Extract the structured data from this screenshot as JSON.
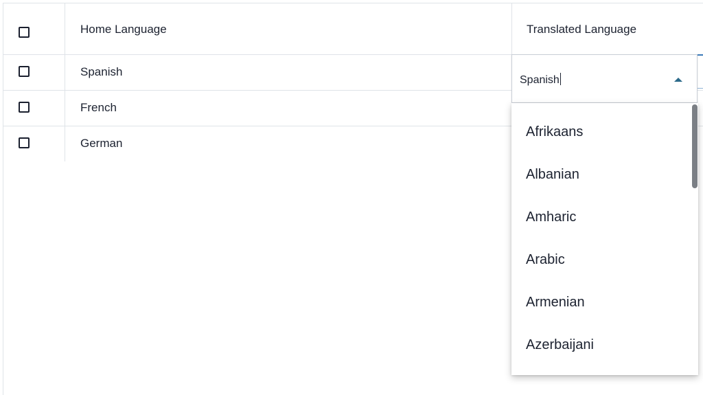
{
  "table": {
    "columns": {
      "home_language": "Home Language",
      "translated_language": "Translated Language"
    },
    "rows": [
      {
        "home_language": "Spanish"
      },
      {
        "home_language": "French"
      },
      {
        "home_language": "German"
      }
    ]
  },
  "dropdown": {
    "input_value": "Spanish",
    "arrow_icon": "triangle-up-icon",
    "options": [
      "Afrikaans",
      "Albanian",
      "Amharic",
      "Arabic",
      "Armenian",
      "Azerbaijani"
    ]
  },
  "colors": {
    "border": "#dfe3e8",
    "arrow": "#2c6a8a",
    "scroll_thumb": "#7b7f85",
    "text": "#1c2230"
  }
}
